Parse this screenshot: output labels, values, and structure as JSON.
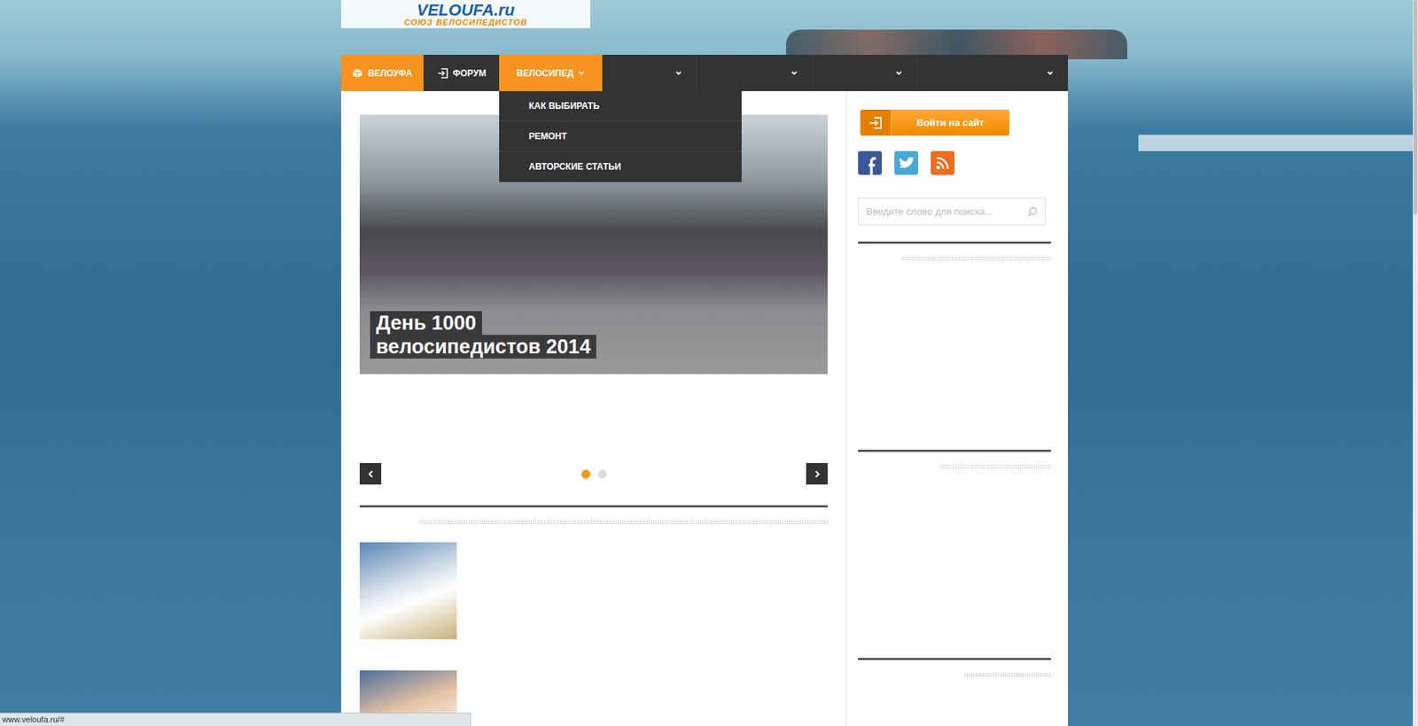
{
  "logo": {
    "title": "VELOUFA.ru",
    "subtitle": "СОЮЗ ВЕЛОСИПЕДИСТОВ"
  },
  "nav": [
    {
      "label": "ВЕЛОУФА",
      "kind": "home",
      "selected": true,
      "expanded": false
    },
    {
      "label": "ФОРУМ",
      "kind": "forum",
      "selected": false,
      "expanded": false
    },
    {
      "label": "ВЕЛОСИПЕД",
      "kind": "menu",
      "selected": false,
      "expanded": true
    },
    {
      "label": "",
      "kind": "menu",
      "selected": false,
      "expanded": false
    },
    {
      "label": "",
      "kind": "menu",
      "selected": false,
      "expanded": false
    },
    {
      "label": "",
      "kind": "menu",
      "selected": false,
      "expanded": false
    },
    {
      "label": "",
      "kind": "menu",
      "selected": false,
      "expanded": false
    }
  ],
  "submenu": [
    "КАК ВЫБИРАТЬ",
    "РЕМОНТ",
    "АВТОРСКИЕ СТАТЬИ"
  ],
  "slider": {
    "caption_lines": [
      "День 1000",
      "велосипедистов 2014"
    ],
    "dots": [
      {
        "selected": true
      },
      {
        "selected": false
      }
    ]
  },
  "login": {
    "label": "Войти на сайт"
  },
  "search": {
    "placeholder": "Введите слово для поиска..."
  },
  "status_bar": "www.veloufa.ru/#"
}
